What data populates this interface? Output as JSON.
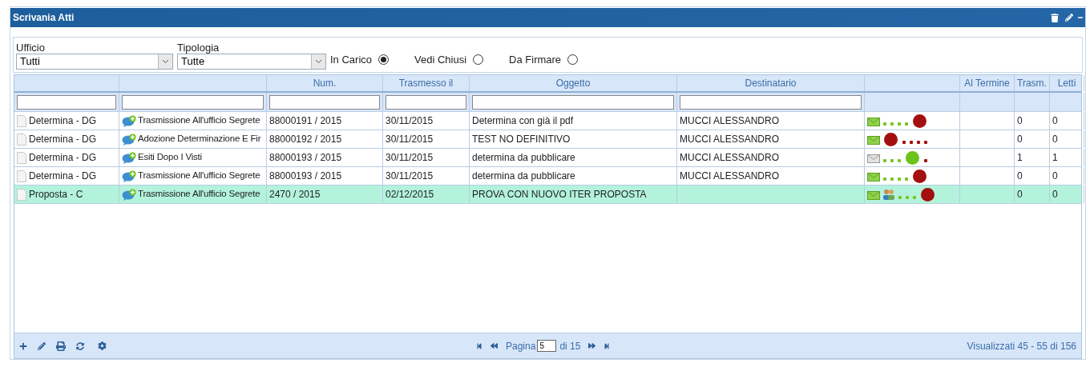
{
  "window": {
    "title": "Scrivania Atti"
  },
  "filters": {
    "ufficio": {
      "label": "Ufficio",
      "value": "Tutti"
    },
    "tipologia": {
      "label": "Tipologia",
      "value": "Tutte"
    },
    "radios": [
      {
        "label": "In Carico",
        "selected": true
      },
      {
        "label": "Vedi Chiusi",
        "selected": false
      },
      {
        "label": "Da Firmare",
        "selected": false
      }
    ]
  },
  "table": {
    "columns": [
      {},
      {},
      {
        "label": "Num."
      },
      {
        "label": "Trasmesso il"
      },
      {
        "label": "Oggetto"
      },
      {
        "label": "Destinatario"
      },
      {},
      {
        "label": "Al Termine"
      },
      {
        "label": "Trasm."
      },
      {
        "label": "Letti"
      }
    ],
    "rows": [
      {
        "selected": false,
        "tipo": "Determina - DG",
        "passo": "Trasmissione All'ufficio Segrete",
        "num": "88000191 / 2015",
        "data": "30/11/2015",
        "oggetto": "Determina con già il pdf",
        "destinatario": "MUCCI ALESSANDRO",
        "status": {
          "read": false,
          "people": false,
          "marks": [
            {
              "kind": "dot",
              "color": "#7ac520"
            },
            {
              "kind": "dot",
              "color": "#7ac520"
            },
            {
              "kind": "dot",
              "color": "#7ac520"
            },
            {
              "kind": "dot",
              "color": "#7ac520"
            },
            {
              "kind": "ball",
              "color": "#a40f0f"
            }
          ]
        },
        "trasm": "0",
        "letti": "0"
      },
      {
        "selected": false,
        "tipo": "Determina - DG",
        "passo": "Adozione Determinazione E Fir",
        "num": "88000192 / 2015",
        "data": "30/11/2015",
        "oggetto": "TEST NO DEFINITIVO",
        "destinatario": "MUCCI ALESSANDRO",
        "status": {
          "read": false,
          "people": false,
          "marks": [
            {
              "kind": "ball",
              "color": "#a40f0f"
            },
            {
              "kind": "dot",
              "color": "#a40f0f"
            },
            {
              "kind": "dot",
              "color": "#a40f0f"
            },
            {
              "kind": "dot",
              "color": "#a40f0f"
            },
            {
              "kind": "dot",
              "color": "#a40f0f"
            }
          ]
        },
        "trasm": "0",
        "letti": "0"
      },
      {
        "selected": false,
        "tipo": "Determina - DG",
        "passo": "Esiti Dopo I Visti",
        "num": "88000193 / 2015",
        "data": "30/11/2015",
        "oggetto": "determina da pubblicare",
        "destinatario": "MUCCI ALESSANDRO",
        "status": {
          "read": true,
          "people": false,
          "marks": [
            {
              "kind": "dot",
              "color": "#7ac520"
            },
            {
              "kind": "dot",
              "color": "#7ac520"
            },
            {
              "kind": "dot",
              "color": "#7ac520"
            },
            {
              "kind": "ball",
              "color": "#6cc31c"
            },
            {
              "kind": "dot",
              "color": "#a40f0f"
            }
          ]
        },
        "trasm": "1",
        "letti": "1"
      },
      {
        "selected": false,
        "tipo": "Determina - DG",
        "passo": "Trasmissione All'ufficio Segrete",
        "num": "88000193 / 2015",
        "data": "30/11/2015",
        "oggetto": "determina da pubblicare",
        "destinatario": "MUCCI ALESSANDRO",
        "status": {
          "read": false,
          "people": false,
          "marks": [
            {
              "kind": "dot",
              "color": "#7ac520"
            },
            {
              "kind": "dot",
              "color": "#7ac520"
            },
            {
              "kind": "dot",
              "color": "#7ac520"
            },
            {
              "kind": "dot",
              "color": "#7ac520"
            },
            {
              "kind": "ball",
              "color": "#a40f0f"
            }
          ]
        },
        "trasm": "0",
        "letti": "0"
      },
      {
        "selected": true,
        "tipo": "Proposta - C",
        "passo": "Trasmissione All'ufficio Segrete",
        "num": "2470 / 2015",
        "data": "02/12/2015",
        "oggetto": "PROVA CON NUOVO ITER PROPOSTA",
        "status": {
          "read": false,
          "people": true,
          "marks": [
            {
              "kind": "dot",
              "color": "#7ac520"
            },
            {
              "kind": "dot",
              "color": "#7ac520"
            },
            {
              "kind": "dot",
              "color": "#7ac520"
            },
            {
              "kind": "ball",
              "color": "#a40f0f"
            }
          ]
        },
        "trasm": "0",
        "letti": "0"
      }
    ]
  },
  "pager": {
    "label": "Pagina",
    "page": "5",
    "total": "di 15",
    "summary": "Visualizzati 45 - 55 di 156"
  }
}
